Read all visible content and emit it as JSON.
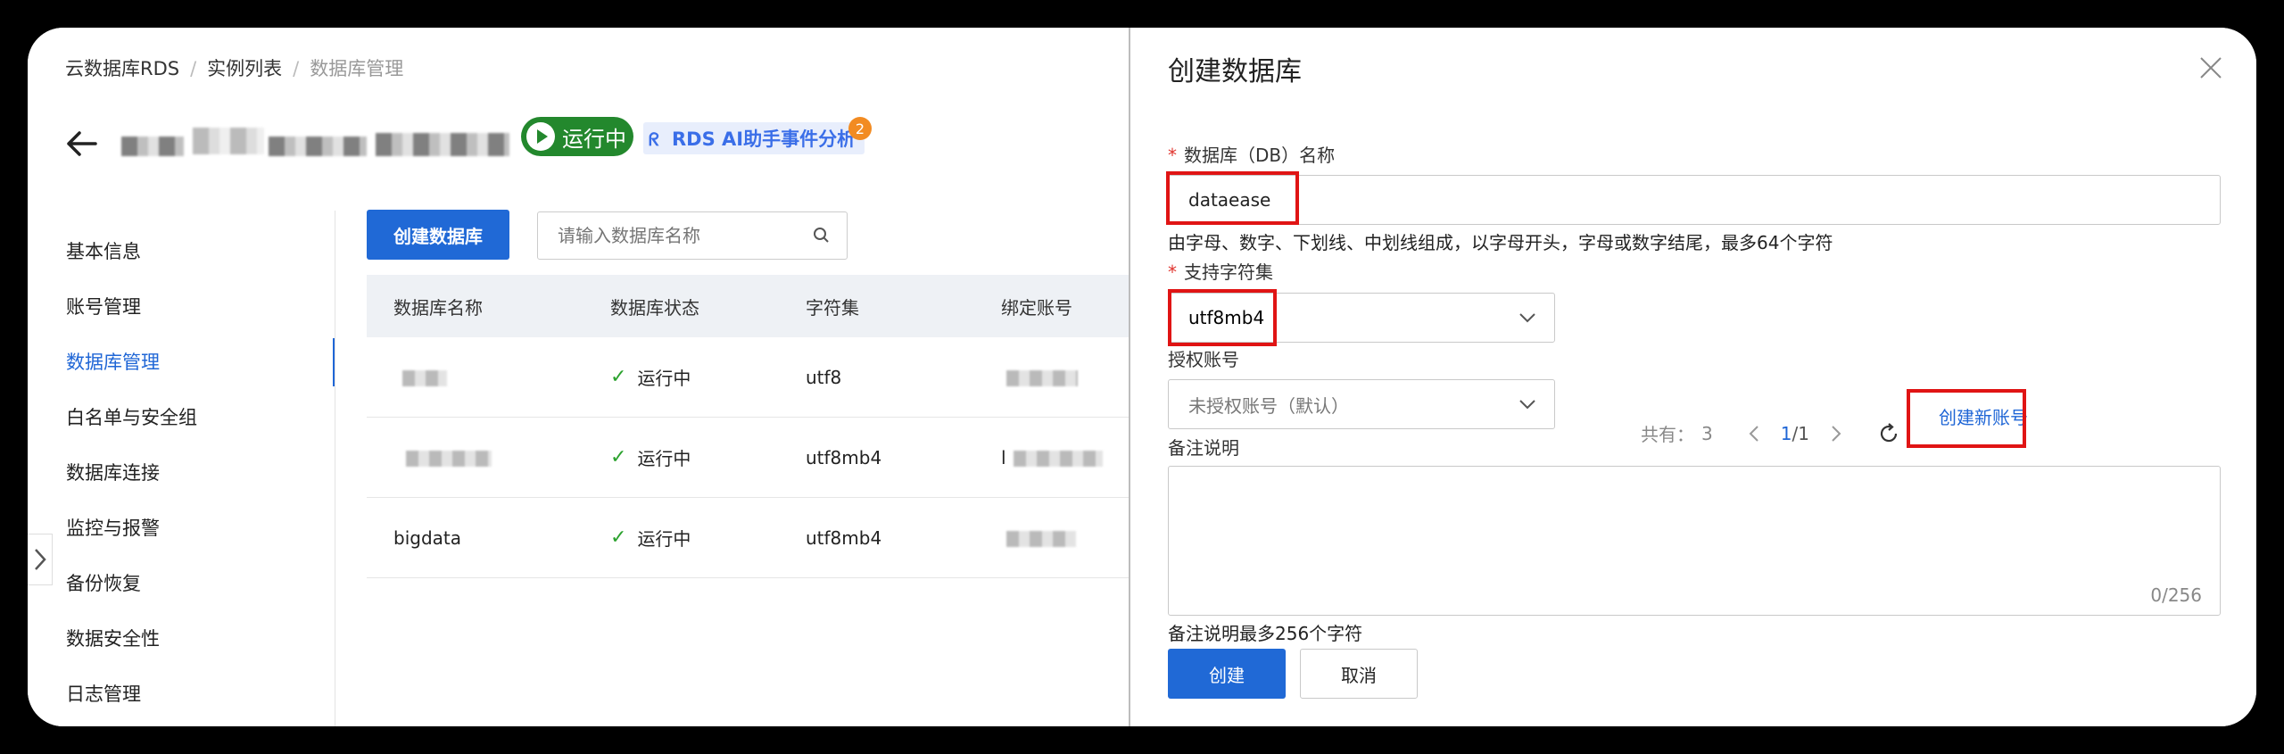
{
  "breadcrumb": {
    "item1": "云数据库RDS",
    "item2": "实例列表",
    "current": "数据库管理",
    "sep": "/"
  },
  "instance": {
    "status": "运行中",
    "ai_tag": "RDS AI助手事件分析",
    "ai_badge": "2"
  },
  "sidebar": {
    "items": [
      "基本信息",
      "账号管理",
      "数据库管理",
      "白名单与安全组",
      "数据库连接",
      "监控与报警",
      "备份恢复",
      "数据安全性",
      "日志管理"
    ],
    "active": "数据库管理"
  },
  "toolbar": {
    "create_label": "创建数据库",
    "search_placeholder": "请输入数据库名称"
  },
  "table": {
    "headers": [
      "数据库名称",
      "数据库状态",
      "字符集",
      "绑定账号"
    ],
    "rows": [
      {
        "name": "",
        "status": "运行中",
        "charset": "utf8"
      },
      {
        "name": "",
        "status": "运行中",
        "charset": "utf8mb4",
        "account_prefix": "l"
      },
      {
        "name": "bigdata",
        "status": "运行中",
        "charset": "utf8mb4"
      }
    ]
  },
  "drawer": {
    "title": "创建数据库",
    "db_name_label": "数据库（DB）名称",
    "required_mark": "*",
    "db_name_value": "dataease",
    "db_name_hint": "由字母、数字、下划线、中划线组成，以字母开头，字母或数字结尾，最多64个字符",
    "charset_label": "支持字符集",
    "charset_value": "utf8mb4",
    "auth_label": "授权账号",
    "auth_value": "未授权账号（默认）",
    "pager_total_label": "共有：",
    "pager_total": "3",
    "pager_page": "1",
    "pager_pages": "/1",
    "new_account_label": "创建新账号",
    "remark_label": "备注说明",
    "remark_count": "0/256",
    "remark_hint": "备注说明最多256个字符",
    "create_label": "创建",
    "cancel_label": "取消"
  },
  "colors": {
    "primary": "#2069d6",
    "running": "#23882d",
    "annotation": "#e01414"
  }
}
